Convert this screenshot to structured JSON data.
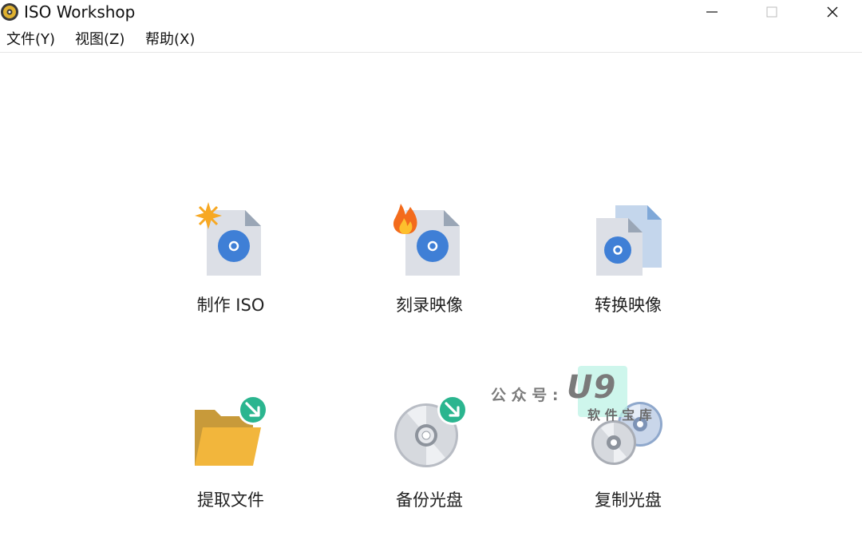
{
  "window": {
    "title": "ISO Workshop"
  },
  "menu": {
    "file": "文件(Y)",
    "view": "视图(Z)",
    "help": "帮助(X)"
  },
  "actions": [
    {
      "label": "制作 ISO",
      "icon": "new-iso-icon"
    },
    {
      "label": "刻录映像",
      "icon": "burn-image-icon"
    },
    {
      "label": "转换映像",
      "icon": "convert-image-icon"
    },
    {
      "label": "提取文件",
      "icon": "extract-files-icon"
    },
    {
      "label": "备份光盘",
      "icon": "backup-disc-icon"
    },
    {
      "label": "复制光盘",
      "icon": "copy-disc-icon"
    }
  ],
  "watermark": {
    "prefix": "公 众 号 :",
    "logo": "U9",
    "subtitle": "软 件 宝 库"
  },
  "colors": {
    "disc_blue": "#3f7fd6",
    "page_gray": "#dcdfe6",
    "folder_yellow": "#f2b63c",
    "badge_green": "#2bb58f",
    "flame_orange": "#f36b1c"
  }
}
